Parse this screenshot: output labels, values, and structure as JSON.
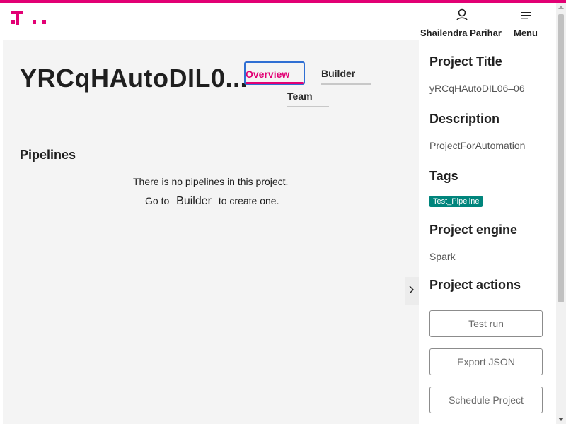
{
  "brand": {
    "accent_color": "#e20074",
    "logo_icon": "telekom-t-logo-icon"
  },
  "header": {
    "user_icon": "user-icon",
    "user_name": "Shailendra Parihar",
    "menu_icon": "hamburger-menu-icon",
    "menu_label": "Menu"
  },
  "main": {
    "project_name": "YRCqHAutoDIL0...",
    "tabs": [
      {
        "label": "Overview",
        "active": true
      },
      {
        "label": "Builder",
        "active": false
      },
      {
        "label": "Team",
        "active": false
      }
    ],
    "pipelines": {
      "title": "Pipelines",
      "empty_line1": "There is no pipelines in this project.",
      "empty_line2_prefix": "Go to",
      "empty_line2_link": "Builder",
      "empty_line2_suffix": "to create one."
    },
    "collapse_icon": "chevron-right-icon"
  },
  "sidebar": {
    "project_title_heading": "Project Title",
    "project_title_value": "yRCqHAutoDIL06–06",
    "description_heading": "Description",
    "description_value": "ProjectForAutomation",
    "tags_heading": "Tags",
    "tags": [
      "Test_Pipeline"
    ],
    "tag_color": "#00857c",
    "engine_heading": "Project engine",
    "engine_value": "Spark",
    "actions_heading": "Project actions",
    "actions": [
      "Test run",
      "Export JSON",
      "Schedule Project"
    ]
  }
}
